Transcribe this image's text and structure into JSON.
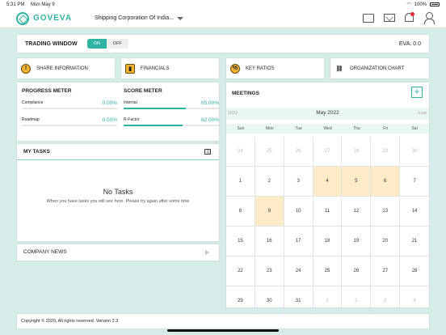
{
  "status_bar": {
    "time": "5:31 PM",
    "date": "Mon May 9",
    "battery": "100%"
  },
  "header": {
    "logo_text": "GOVEVA",
    "company": "Shipping Corporation Of India...",
    "accent": "#2eb3a3"
  },
  "trading": {
    "label": "TRADING WINDOW",
    "on": "ON",
    "off": "OFF",
    "eva": "EVA: 0.0"
  },
  "quick_links": [
    {
      "label": "SHARE INFORMATION",
      "glyph": "!"
    },
    {
      "label": "FINANCIALS",
      "glyph": "▮"
    },
    {
      "label": "KEY RATIOS",
      "glyph": "%"
    },
    {
      "label": "ORGANIZATION CHART",
      "glyph": "⛓"
    }
  ],
  "progress_meter": {
    "title": "PROGRESS METER",
    "items": [
      {
        "label": "Compliance",
        "value": "0.00%",
        "fraction": 0.0
      },
      {
        "label": "Roadmap",
        "value": "0.00%",
        "fraction": 0.0
      }
    ]
  },
  "score_meter": {
    "title": "SCORE METER",
    "items": [
      {
        "label": "Internal",
        "value": "65.00%",
        "fraction": 0.65
      },
      {
        "label": "R-Factor",
        "value": "62.00%",
        "fraction": 0.62
      }
    ]
  },
  "tasks": {
    "title": "MY TASKS",
    "empty_title": "No Tasks",
    "empty_text": "When you have tasks you will see here. Please try again after some time"
  },
  "news": {
    "title": "COMPANY NEWS"
  },
  "meetings": {
    "title": "MEETINGS",
    "prev_label": "2022",
    "month_label": "May 2022",
    "next_label": "June",
    "weekdays": [
      "Sun",
      "Mon",
      "Tue",
      "Wed",
      "Thu",
      "Fri",
      "Sat"
    ],
    "days": [
      {
        "d": "24",
        "muted": true
      },
      {
        "d": "25",
        "muted": true
      },
      {
        "d": "26",
        "muted": true
      },
      {
        "d": "27",
        "muted": true
      },
      {
        "d": "28",
        "muted": true
      },
      {
        "d": "29",
        "muted": true
      },
      {
        "d": "30",
        "muted": true
      },
      {
        "d": "1"
      },
      {
        "d": "2"
      },
      {
        "d": "3"
      },
      {
        "d": "4",
        "event": true
      },
      {
        "d": "5",
        "event": true
      },
      {
        "d": "6",
        "event": true
      },
      {
        "d": "7"
      },
      {
        "d": "8"
      },
      {
        "d": "9",
        "event": true
      },
      {
        "d": "10"
      },
      {
        "d": "11"
      },
      {
        "d": "12"
      },
      {
        "d": "13"
      },
      {
        "d": "14"
      },
      {
        "d": "15"
      },
      {
        "d": "16"
      },
      {
        "d": "17"
      },
      {
        "d": "18"
      },
      {
        "d": "19"
      },
      {
        "d": "20"
      },
      {
        "d": "21"
      },
      {
        "d": "22"
      },
      {
        "d": "23"
      },
      {
        "d": "24"
      },
      {
        "d": "25"
      },
      {
        "d": "26"
      },
      {
        "d": "27"
      },
      {
        "d": "28"
      },
      {
        "d": "29"
      },
      {
        "d": "30"
      },
      {
        "d": "31"
      },
      {
        "d": "1",
        "muted": true
      },
      {
        "d": "2",
        "muted": true
      },
      {
        "d": "3",
        "muted": true
      },
      {
        "d": "4",
        "muted": true
      }
    ]
  },
  "footer": {
    "text": "Copyright © 2020, All rights reserved. Version 2.3"
  }
}
